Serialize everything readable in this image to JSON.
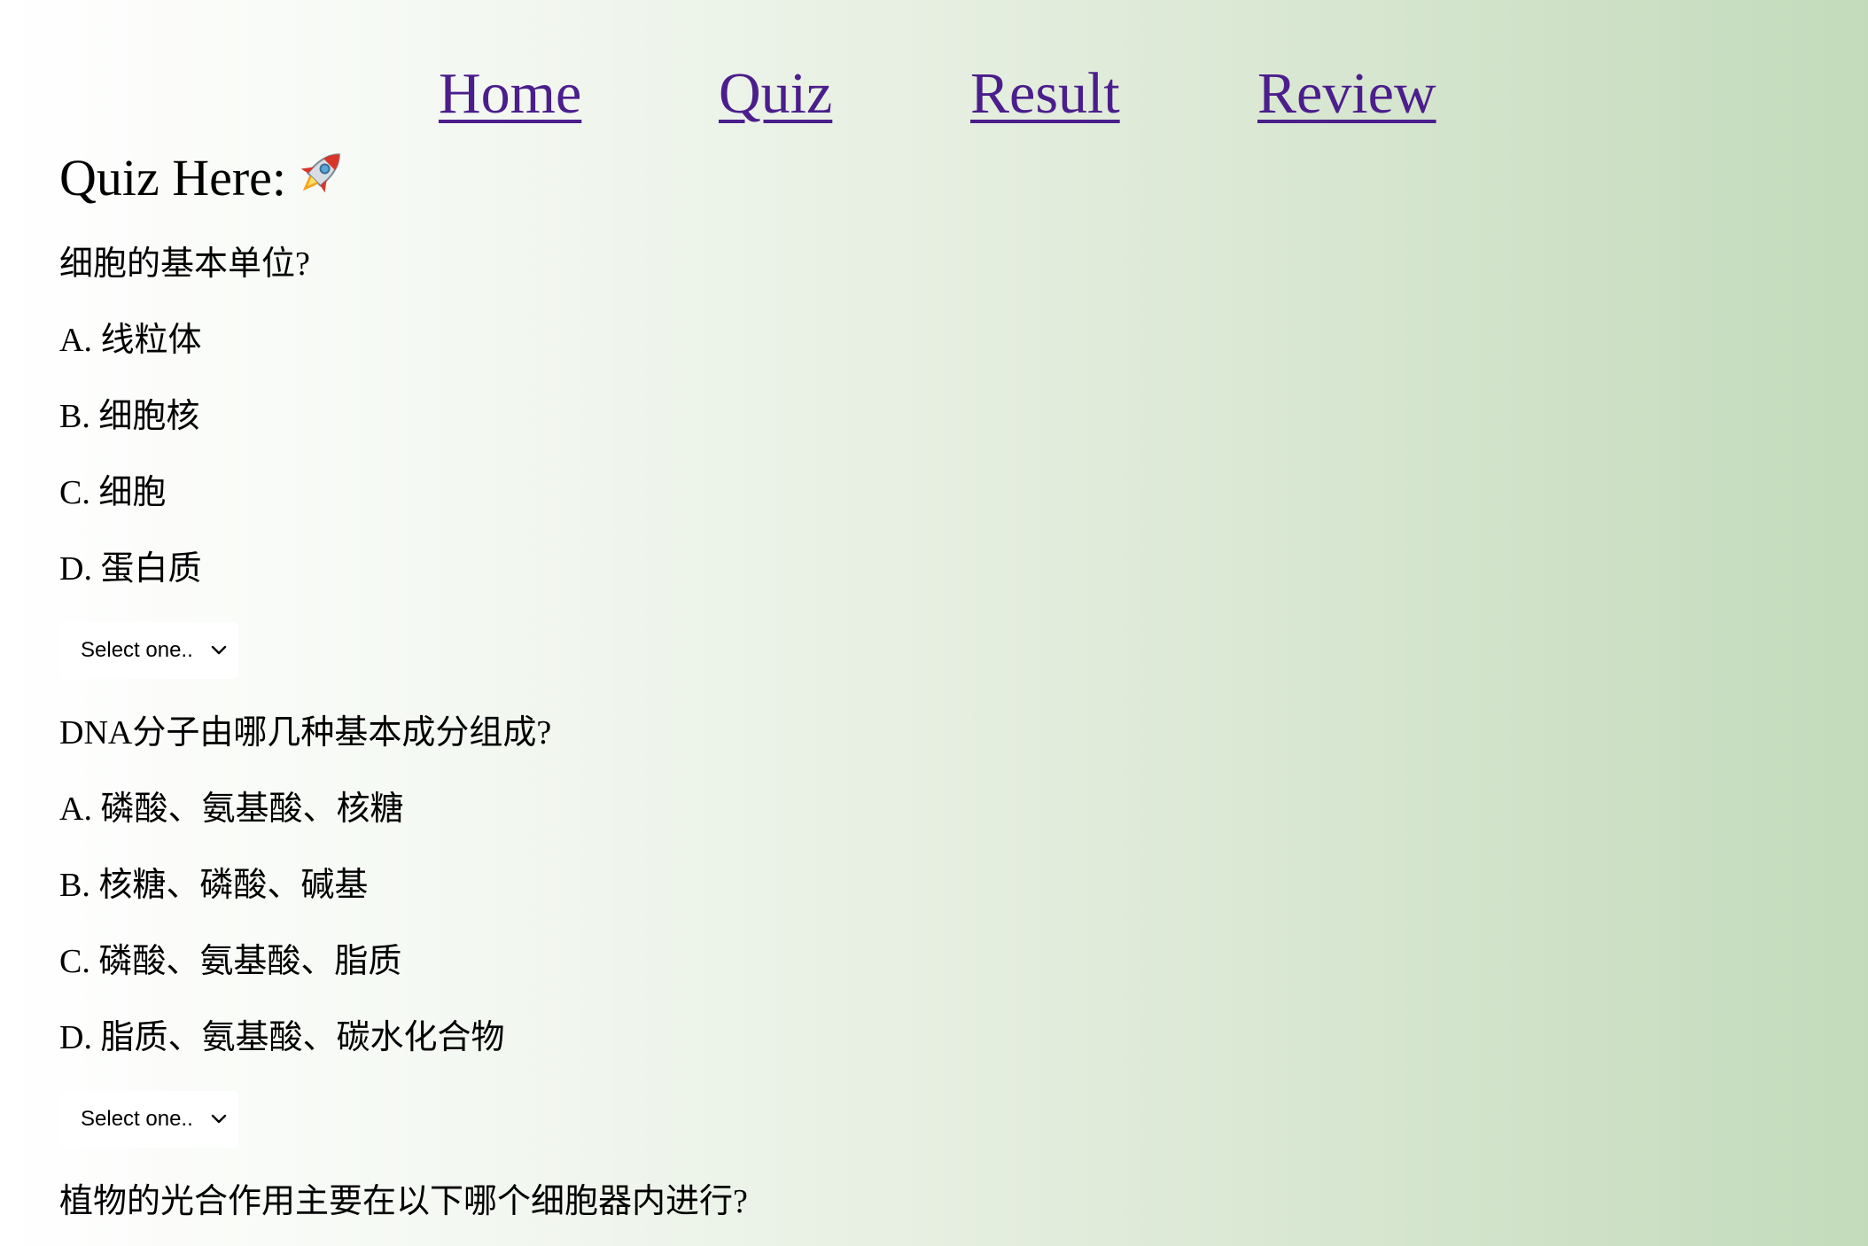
{
  "nav": {
    "home": "Home",
    "quiz": "Quiz",
    "result": "Result",
    "review": "Review"
  },
  "page": {
    "title": "Quiz Here:",
    "title_icon": "rocket-icon"
  },
  "questions": [
    {
      "text": "细胞的基本单位?",
      "options": [
        "A. 线粒体",
        "B. 细胞核",
        "C. 细胞",
        "D. 蛋白质"
      ],
      "select_value": "Select one.."
    },
    {
      "text": "DNA分子由哪几种基本成分组成?",
      "options": [
        "A. 磷酸、氨基酸、核糖",
        "B. 核糖、磷酸、碱基",
        "C. 磷酸、氨基酸、脂质",
        "D. 脂质、氨基酸、碳水化合物"
      ],
      "select_value": "Select one.."
    },
    {
      "text": "植物的光合作用主要在以下哪个细胞器内进行?"
    }
  ],
  "colors": {
    "link": "#4b1e8c",
    "background_start": "#ffffff",
    "background_end": "#c3dbbb"
  }
}
